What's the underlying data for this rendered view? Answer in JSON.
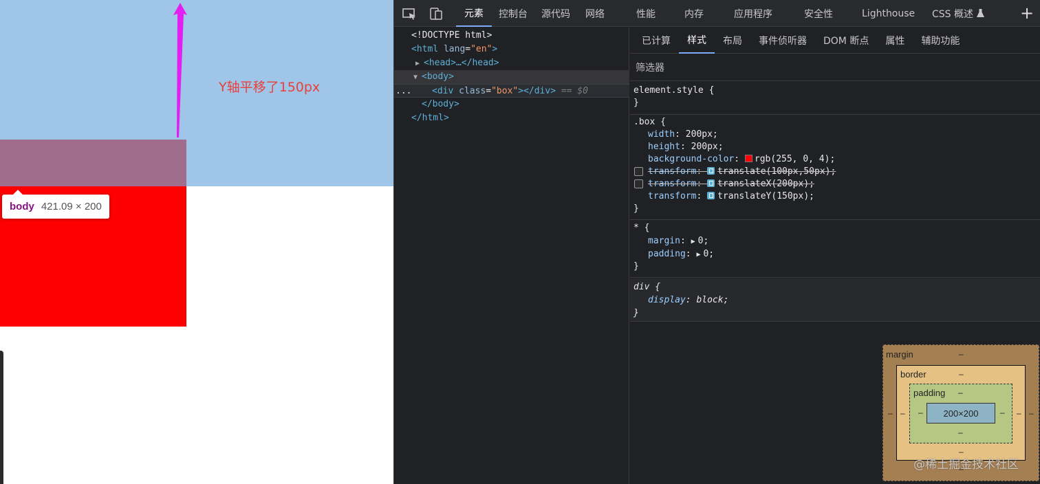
{
  "page": {
    "annotation": "Y轴平移了150px",
    "tooltip": {
      "tag": "body",
      "size": "421.09 × 200"
    },
    "colors": {
      "body_highlight": "#9fc5e8",
      "box": "#ff0000",
      "annotation": "#e8413a",
      "arrow": "#e31ef0"
    }
  },
  "devtools": {
    "toolbar": {
      "inspect_icon": "inspect-element-icon",
      "device_icon": "device-toolbar-icon",
      "more_icon": "plus-icon"
    },
    "tabs": [
      {
        "label": "元素",
        "active": true
      },
      {
        "label": "控制台"
      },
      {
        "label": "源代码"
      },
      {
        "label": "网络"
      },
      {
        "label": "性能"
      },
      {
        "label": "内存"
      },
      {
        "label": "应用程序"
      },
      {
        "label": "安全性"
      },
      {
        "label": "Lighthouse"
      },
      {
        "label": "CSS 概述"
      }
    ],
    "dom": {
      "doctype": "<!DOCTYPE html>",
      "html_open": "<html",
      "html_attr": "lang",
      "html_attr_val": "\"en\"",
      "head": "<head>…</head>",
      "body_open": "<body>",
      "div_open": "<div",
      "div_attr": "class",
      "div_attr_val": "\"box\"",
      "div_close": "></div>",
      "div_marker": "== $0",
      "ellipsis": "...",
      "body_close": "</body>",
      "html_close": "</html>"
    },
    "subtabs": [
      {
        "label": "已计算"
      },
      {
        "label": "样式",
        "active": true
      },
      {
        "label": "布局"
      },
      {
        "label": "事件侦听器"
      },
      {
        "label": "DOM 断点"
      },
      {
        "label": "属性"
      },
      {
        "label": "辅助功能"
      }
    ],
    "filter": {
      "placeholder": "筛选器"
    },
    "rules": {
      "element_style": {
        "selector": "element.style {",
        "close": "}"
      },
      "box": {
        "selector": ".box {",
        "width_name": "width",
        "width_val": "200px;",
        "height_name": "height",
        "height_val": "200px;",
        "bg_name": "background-color",
        "bg_val": "rgb(255, 0, 4);",
        "bg_color": "#ff0004",
        "t1_name": "transform",
        "t1_val": "translate(100px,50px);",
        "t2_name": "transform",
        "t2_val": "translateX(200px);",
        "t3_name": "transform",
        "t3_val": "translateY(150px);",
        "close": "}"
      },
      "universal": {
        "selector": "* {",
        "margin_name": "margin",
        "margin_val": "0;",
        "padding_name": "padding",
        "padding_val": "0;",
        "close": "}"
      },
      "ua_div": {
        "selector": "div {",
        "display_name": "display",
        "display_val": "block;",
        "close": "}"
      }
    },
    "box_model": {
      "margin_label": "margin",
      "border_label": "border",
      "padding_label": "padding",
      "content": "200×200",
      "dash": "–"
    }
  },
  "watermark": "@稀土掘金技术社区"
}
